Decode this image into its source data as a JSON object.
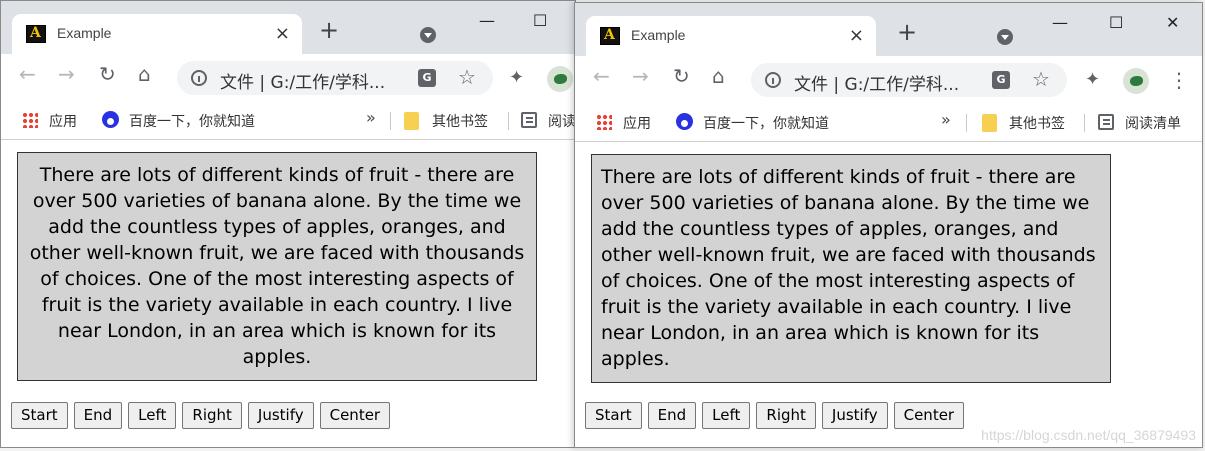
{
  "tab": {
    "title": "Example",
    "close": "×"
  },
  "new_tab": "+",
  "window_controls": {
    "minimize": "—",
    "maximize": "☐",
    "close": "✕"
  },
  "nav": {
    "back": "←",
    "forward": "→",
    "reload": "↻",
    "home": "⌂"
  },
  "omnibox": {
    "text": "文件 | G:/工作/学科..."
  },
  "translate_label": "G",
  "star": "☆",
  "extensions": "✦",
  "menu": "⋮",
  "bookmarks": {
    "apps": "应用",
    "baidu": "百度一下，你就知道",
    "more": "»",
    "other": "其他书签",
    "reading_left": "阅读",
    "reading_right": "阅读清单"
  },
  "paragraph": "There are lots of different kinds of fruit - there are over 500 varieties of banana alone. By the time we add the countless types of apples, oranges, and other well-known fruit, we are faced with thousands of choices. One of the most interesting aspects of fruit is the variety available in each country. I live near London, in an area which is known for its apples.",
  "buttons": [
    "Start",
    "End",
    "Left",
    "Right",
    "Justify",
    "Center"
  ],
  "watermark": "https://blog.csdn.net/qq_36879493",
  "colors": {
    "titlebar": "#dee1e6",
    "paragraph_bg": "#d3d3d3",
    "button_bg": "#efefef"
  },
  "icons": [
    "back-icon",
    "forward-icon",
    "reload-icon",
    "home-icon",
    "info-icon",
    "translate-icon",
    "star-icon",
    "extensions-icon",
    "profile-avatar",
    "menu-icon",
    "apps-icon",
    "baidu-icon",
    "folder-icon",
    "reading-list-icon"
  ]
}
